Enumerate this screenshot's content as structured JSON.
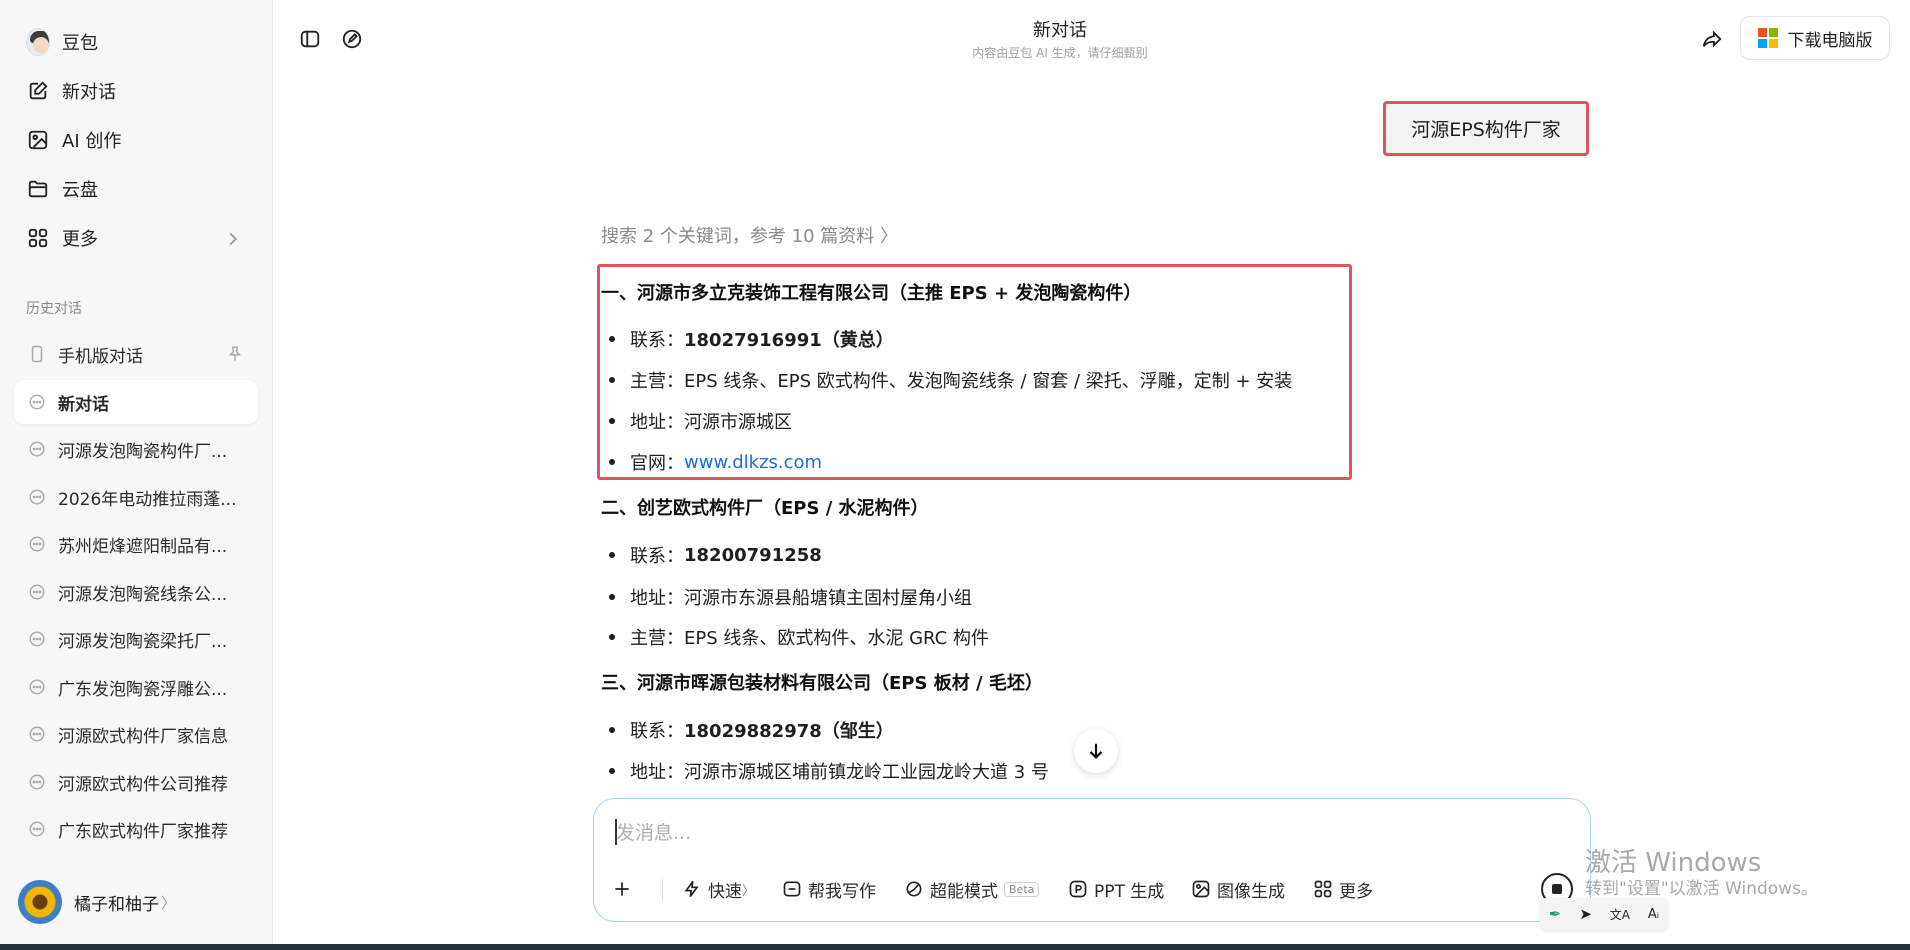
{
  "sidebar": {
    "brand": "豆包",
    "nav": [
      {
        "label": "新对话",
        "icon": "new-chat-icon"
      },
      {
        "label": "AI 创作",
        "icon": "image-icon"
      },
      {
        "label": "云盘",
        "icon": "folder-icon"
      },
      {
        "label": "更多",
        "icon": "grid-icon"
      }
    ],
    "history_title": "历史对话",
    "history": [
      "手机版对话",
      "新对话",
      "河源发泡陶瓷构件厂...",
      "2026年电动推拉雨蓬...",
      "苏州炬烽遮阳制品有...",
      "河源发泡陶瓷线条公...",
      "河源发泡陶瓷梁托厂...",
      "广东发泡陶瓷浮雕公...",
      "河源欧式构件厂家信息",
      "河源欧式构件公司推荐",
      "广东欧式构件厂家推荐"
    ],
    "active_index": 1,
    "user_name": "橘子和柚子",
    "user_chevron": "〉"
  },
  "header": {
    "title": "新对话",
    "subtitle": "内容由豆包 AI 生成，请仔细甄别",
    "download_label": "下载电脑版"
  },
  "chat": {
    "user_message": "河源EPS构件厂家",
    "search_note": "搜索 2 个关键词，参考 10 篇资料 〉",
    "sections": [
      {
        "heading": "一、河源市多立克装饰工程有限公司（主推 EPS + 发泡陶瓷构件）",
        "items": [
          {
            "label": "联系：",
            "value": "18027916991（黄总）",
            "bold": true
          },
          {
            "label": "主营：",
            "value": "EPS 线条、EPS 欧式构件、发泡陶瓷线条 / 窗套 / 梁托、浮雕，定制 + 安装"
          },
          {
            "label": "地址：",
            "value": "河源市源城区"
          },
          {
            "label": "官网：",
            "value": "www.dlkzs.com",
            "link": true
          }
        ]
      },
      {
        "heading": "二、创艺欧式构件厂（EPS / 水泥构件）",
        "items": [
          {
            "label": "联系：",
            "value": "18200791258",
            "bold": true
          },
          {
            "label": "地址：",
            "value": "河源市东源县船塘镇主固村屋角小组"
          },
          {
            "label": "主营：",
            "value": "EPS 线条、欧式构件、水泥 GRC 构件"
          }
        ]
      },
      {
        "heading": "三、河源市晖源包装材料有限公司（EPS 板材 / 毛坯）",
        "items": [
          {
            "label": "联系：",
            "value": "18029882978（邹生）",
            "bold": true
          },
          {
            "label": "地址：",
            "value": "河源市源城区埔前镇龙岭工业园龙岭大道 3 号"
          }
        ]
      }
    ]
  },
  "composer": {
    "placeholder": "发消息...",
    "tools": [
      {
        "label": "快速",
        "icon": "lightning-icon",
        "suffix": "〉"
      },
      {
        "label": "帮我写作",
        "icon": "write-icon"
      },
      {
        "label": "超能模式",
        "icon": "sparkle-icon",
        "badge": "Beta"
      },
      {
        "label": "PPT 生成",
        "icon": "ppt-icon"
      },
      {
        "label": "图像生成",
        "icon": "image-gen-icon"
      },
      {
        "label": "更多",
        "icon": "grid-icon"
      }
    ]
  },
  "mini_toolbar": [
    "✒",
    "➤",
    "文A",
    "Aᵢ"
  ],
  "windows_watermark": {
    "title": "激活 Windows",
    "subtitle": "转到\"设置\"以激活 Windows。"
  },
  "colors": {
    "accent_red": "#e0555c",
    "link_blue": "#1a6fd6",
    "composer_border": "#9fd3ee",
    "sidebar_bg": "#f7f7f8"
  }
}
